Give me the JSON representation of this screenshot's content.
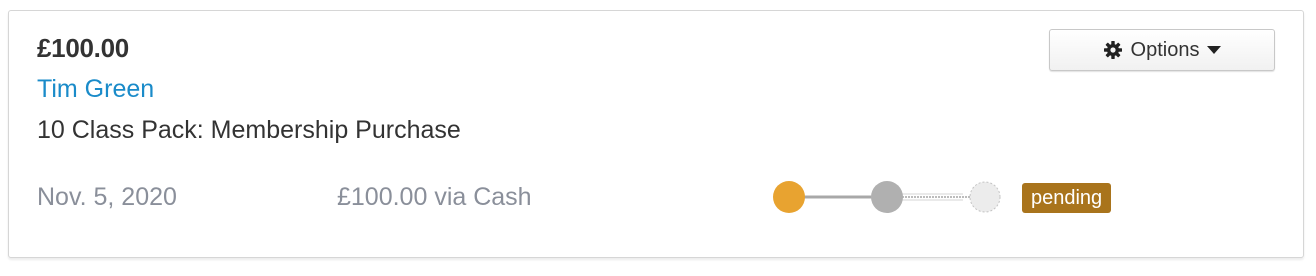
{
  "transaction": {
    "amount": "£100.00",
    "customer_name": "Tim Green",
    "description": "10 Class Pack: Membership Purchase",
    "date": "Nov. 5, 2020",
    "payment_summary": "£100.00 via Cash",
    "status": "pending",
    "status_color": "#a9741c"
  },
  "options_button": {
    "label": "Options",
    "icon": "gear-icon",
    "dropdown_icon": "caret-down-icon"
  },
  "progress_steps": {
    "completed_color": "#e8a330",
    "current_color": "#b0b0b0",
    "upcoming_color": "#ececec",
    "steps": [
      "completed",
      "current",
      "upcoming"
    ]
  }
}
